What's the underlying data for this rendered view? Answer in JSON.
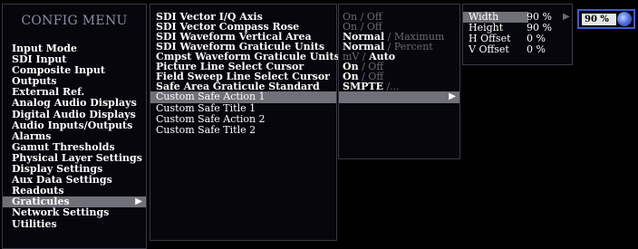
{
  "menu": {
    "title": "CONFIG MENU",
    "items": [
      {
        "label": "Input Mode"
      },
      {
        "label": "SDI Input"
      },
      {
        "label": "Composite Input"
      },
      {
        "label": "Outputs"
      },
      {
        "label": "External Ref."
      },
      {
        "label": "Analog Audio Displays"
      },
      {
        "label": "Digital Audio Displays"
      },
      {
        "label": "Audio Inputs/Outputs"
      },
      {
        "label": "Alarms"
      },
      {
        "label": "Gamut Thresholds"
      },
      {
        "label": "Physical Layer Settings"
      },
      {
        "label": "Display Settings"
      },
      {
        "label": "Aux Data Settings"
      },
      {
        "label": "Readouts"
      },
      {
        "label": "Graticules"
      },
      {
        "label": "Network Settings"
      },
      {
        "label": "Utilities"
      }
    ],
    "selected_index": 14
  },
  "settings": {
    "items": [
      {
        "label": "SDI Vector I/Q Axis",
        "value_on": "On",
        "value_sep": " / ",
        "value_off": "Off"
      },
      {
        "label": "SDI Vector Compass Rose",
        "value_on": "On",
        "value_sep": " / ",
        "value_off": "Off"
      },
      {
        "label": "SDI Waveform Vertical Area",
        "value_on": "Normal",
        "value_sep": " / ",
        "value_off": "Maximum"
      },
      {
        "label": "SDI Waveform Graticule Units",
        "value_on": "Normal",
        "value_sep": " / ",
        "value_off": "Percent"
      },
      {
        "label": "Cmpst Waveform Graticule Units",
        "value_on": "mV",
        "value_sep": " / ",
        "value_off": "Auto"
      },
      {
        "label": "Picture Line Select Cursor",
        "value_on": "On",
        "value_sep": " / ",
        "value_off": "Off"
      },
      {
        "label": "Field Sweep Line Select Cursor",
        "value_on": "On",
        "value_sep": " / ",
        "value_off": "Off"
      },
      {
        "label": "Safe Area Graticule Standard",
        "value_on": "SMPTE",
        "value_sep": " /",
        "value_off": "..."
      }
    ],
    "extra_items": [
      {
        "label": "Custom Safe Action 1"
      },
      {
        "label": "Custom Safe Title 1"
      },
      {
        "label": "Custom Safe Action 2"
      },
      {
        "label": "Custom Safe Title 2"
      }
    ]
  },
  "submenu": {
    "items": [
      {
        "label": "Width",
        "value": "90 %"
      },
      {
        "label": "Height",
        "value": "90 %"
      },
      {
        "label": "H Offset",
        "value": "0 %"
      },
      {
        "label": "V Offset",
        "value": "0 %"
      }
    ]
  },
  "editor": {
    "value": "90 %"
  },
  "colors": {
    "selection": "#707078",
    "knob": "#4a6fe0",
    "title": "#8b8fa8"
  }
}
